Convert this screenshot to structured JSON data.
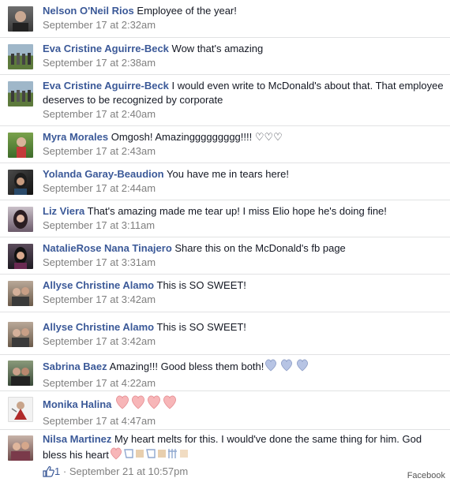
{
  "comments": [
    {
      "name": "Nelson O'Neil Rios",
      "text": "Employee of the year!",
      "time": "September 17 at 2:32am"
    },
    {
      "name": "Eva Cristine Aguirre-Beck",
      "text": "Wow that's amazing",
      "time": "September 17 at 2:38am"
    },
    {
      "name": "Eva Cristine Aguirre-Beck",
      "text": "I would even write to McDonald's about that. That employee deserves to be recognized by corporate",
      "time": "September 17 at 2:40am"
    },
    {
      "name": "Myra Morales",
      "text": "Omgosh! Amazinggggggggg!!!! ♡♡♡",
      "time": "September 17 at 2:43am"
    },
    {
      "name": "Yolanda Garay-Beaudion",
      "text": "You have me in tears here!",
      "time": "September 17 at 2:44am"
    },
    {
      "name": "Liz Viera",
      "text": "That's amazing made me tear up! I miss Elio hope he's doing fine!",
      "time": "September 17 at 3:11am"
    },
    {
      "name": "NatalieRose Nana Tinajero",
      "text": "Share this on the McDonald's fb page",
      "time": "September 17 at 3:31am"
    },
    {
      "name": "Allyse Christine Alamo",
      "text": "This is SO SWEET!",
      "time": "September 17 at 3:42am"
    },
    {
      "name": "Allyse Christine Alamo",
      "text": "This is SO SWEET!",
      "time": "September 17 at 3:42am"
    },
    {
      "name": "Sabrina Baez",
      "text": "Amazing!!! Good bless them both!",
      "time": "September 17 at 4:22am"
    },
    {
      "name": "Monika Halina",
      "text": "",
      "time": "September 17 at 4:47am"
    },
    {
      "name": "Nilsa Martinez",
      "text": "My heart melts for this. I would've done the same thing for him. God bless his heart",
      "time": "September 21 at 10:57pm",
      "likes": "1",
      "separator": "·"
    }
  ],
  "credit": "Facebook",
  "colors": {
    "name": "#3b5998",
    "meta": "#7f7f7f",
    "pink_heart": "#f4a3a8",
    "blue_heart": "#b7c4e4"
  }
}
